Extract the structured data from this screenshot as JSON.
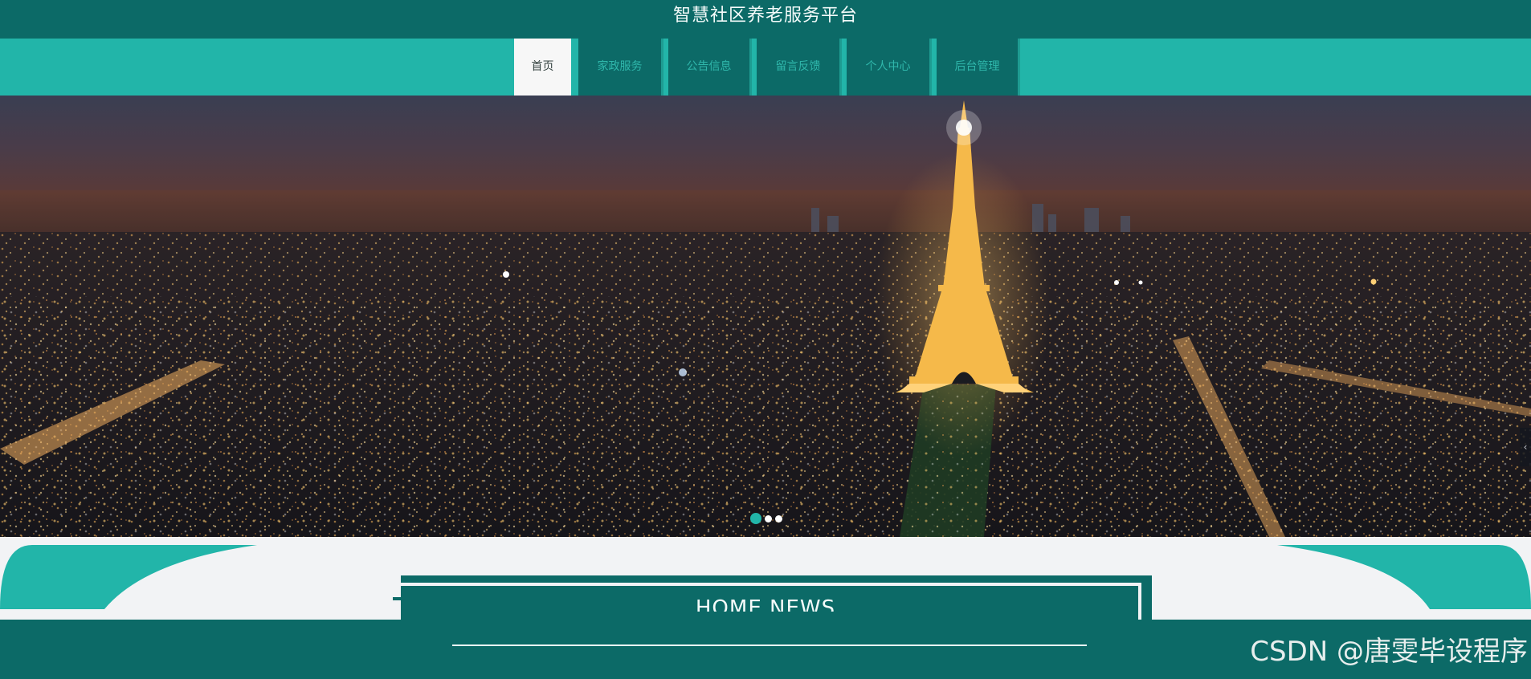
{
  "header": {
    "site_title": "智慧社区养老服务平台"
  },
  "nav": {
    "items": [
      {
        "label": "首页",
        "active": true
      },
      {
        "label": "家政服务",
        "active": false
      },
      {
        "label": "公告信息",
        "active": false
      },
      {
        "label": "留言反馈",
        "active": false
      },
      {
        "label": "个人中心",
        "active": false
      },
      {
        "label": "后台管理",
        "active": false
      }
    ]
  },
  "banner": {
    "image": "paris-eiffel-tower-night-cityscape",
    "next_arrow": "‹",
    "slide_count": 3,
    "active_slide": 1
  },
  "news": {
    "heading": "HOME NEWS"
  },
  "footer": {
    "watermark": "CSDN @唐雯毕设程序"
  },
  "colors": {
    "primary_dark": "#0c6a67",
    "accent_teal": "#22b5a9",
    "page_bg": "#f2f3f5"
  }
}
